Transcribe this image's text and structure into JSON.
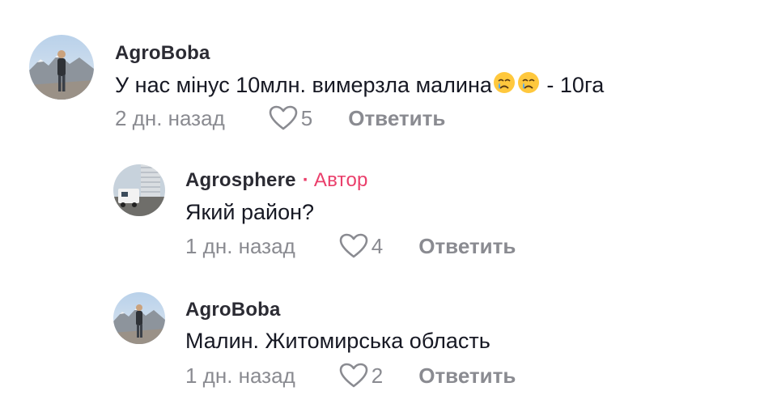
{
  "comments": [
    {
      "username": "AgroBoba",
      "text_before": "У нас мінус 10млн. вимерзла малина",
      "emoji": [
        "crying-face",
        "crying-face"
      ],
      "text_after": " - 10га",
      "time": "2 дн. назад",
      "likes": "5",
      "reply_label": "Ответить"
    },
    {
      "username": "Agrosphere",
      "author_dot": "·",
      "author_label": "Автор",
      "text": "Який район?",
      "time": "1 дн. назад",
      "likes": "4",
      "reply_label": "Ответить"
    },
    {
      "username": "AgroBoba",
      "text": "Малин. Житомирська область",
      "time": "1 дн. назад",
      "likes": "2",
      "reply_label": "Ответить"
    }
  ],
  "colors": {
    "text": "#161823",
    "muted": "#8a8b91",
    "author": "#ea3f6b"
  },
  "icons": {
    "like": "heart-outline-icon",
    "emoji": "crying-face-emoji"
  }
}
